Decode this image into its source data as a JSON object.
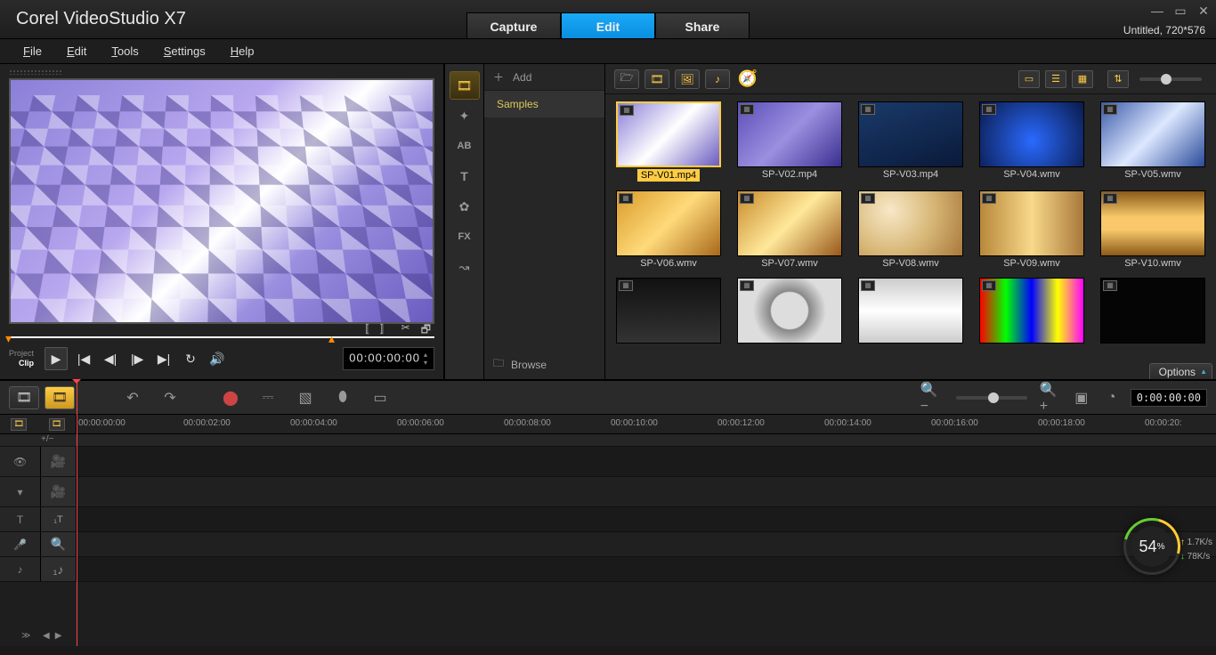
{
  "app": {
    "title": "Corel  VideoStudio X7",
    "document": "Untitled, 720*576"
  },
  "tabs": {
    "capture": "Capture",
    "edit": "Edit",
    "share": "Share",
    "active": "edit"
  },
  "menu": {
    "file": "File",
    "edit": "Edit",
    "tools": "Tools",
    "settings": "Settings",
    "help": "Help"
  },
  "preview": {
    "mode_project": "Project",
    "mode_clip": "Clip",
    "timecode": "00:00:00:00"
  },
  "library": {
    "add_label": "Add",
    "tree_selected": "Samples",
    "browse_label": "Browse",
    "options_label": "Options",
    "thumbs": [
      {
        "label": "SP-V01.mp4",
        "cls": "t1",
        "selected": true
      },
      {
        "label": "SP-V02.mp4",
        "cls": "t2"
      },
      {
        "label": "SP-V03.mp4",
        "cls": "t3"
      },
      {
        "label": "SP-V04.wmv",
        "cls": "t4"
      },
      {
        "label": "SP-V05.wmv",
        "cls": "t5"
      },
      {
        "label": "SP-V06.wmv",
        "cls": "t6"
      },
      {
        "label": "SP-V07.wmv",
        "cls": "t7"
      },
      {
        "label": "SP-V08.wmv",
        "cls": "t8"
      },
      {
        "label": "SP-V09.wmv",
        "cls": "t9"
      },
      {
        "label": "SP-V10.wmv",
        "cls": "t10"
      },
      {
        "label": "",
        "cls": "t11"
      },
      {
        "label": "",
        "cls": "t12"
      },
      {
        "label": "",
        "cls": "t13"
      },
      {
        "label": "",
        "cls": "t14"
      },
      {
        "label": "",
        "cls": "t15"
      }
    ]
  },
  "timeline": {
    "timecode": "0:00:00:00",
    "ruler_start": "00:00:00:00",
    "ticks": [
      "00:00:02:00",
      "00:00:04:00",
      "00:00:06:00",
      "00:00:08:00",
      "00:00:10:00",
      "00:00:12:00",
      "00:00:14:00",
      "00:00:16:00",
      "00:00:18:00",
      "00:00:20:"
    ],
    "leading": "+/−"
  },
  "gauge": {
    "percent": "54",
    "unit": "%",
    "up": "1.7K/s",
    "down": "78K/s"
  }
}
